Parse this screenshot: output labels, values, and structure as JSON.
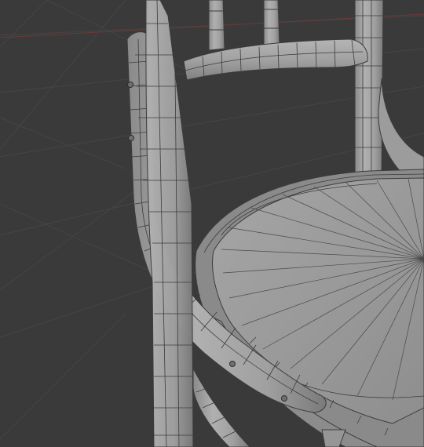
{
  "viewport": {
    "kind": "3d-viewport",
    "shading": "solid-wireframe",
    "background_color": "#3a3a3a",
    "grid_color": "#464646",
    "x_axis_color": "#7a3b3b",
    "mesh_fill_color": "#9a9a9a",
    "mesh_wire_color": "#3c3c3c",
    "model": "bentwood-chair",
    "parts": [
      "back-post-left",
      "back-post-right",
      "back-spindle",
      "back-rail",
      "seat",
      "seat-ring",
      "front-leg",
      "leg-brace",
      "screw-heads"
    ]
  }
}
